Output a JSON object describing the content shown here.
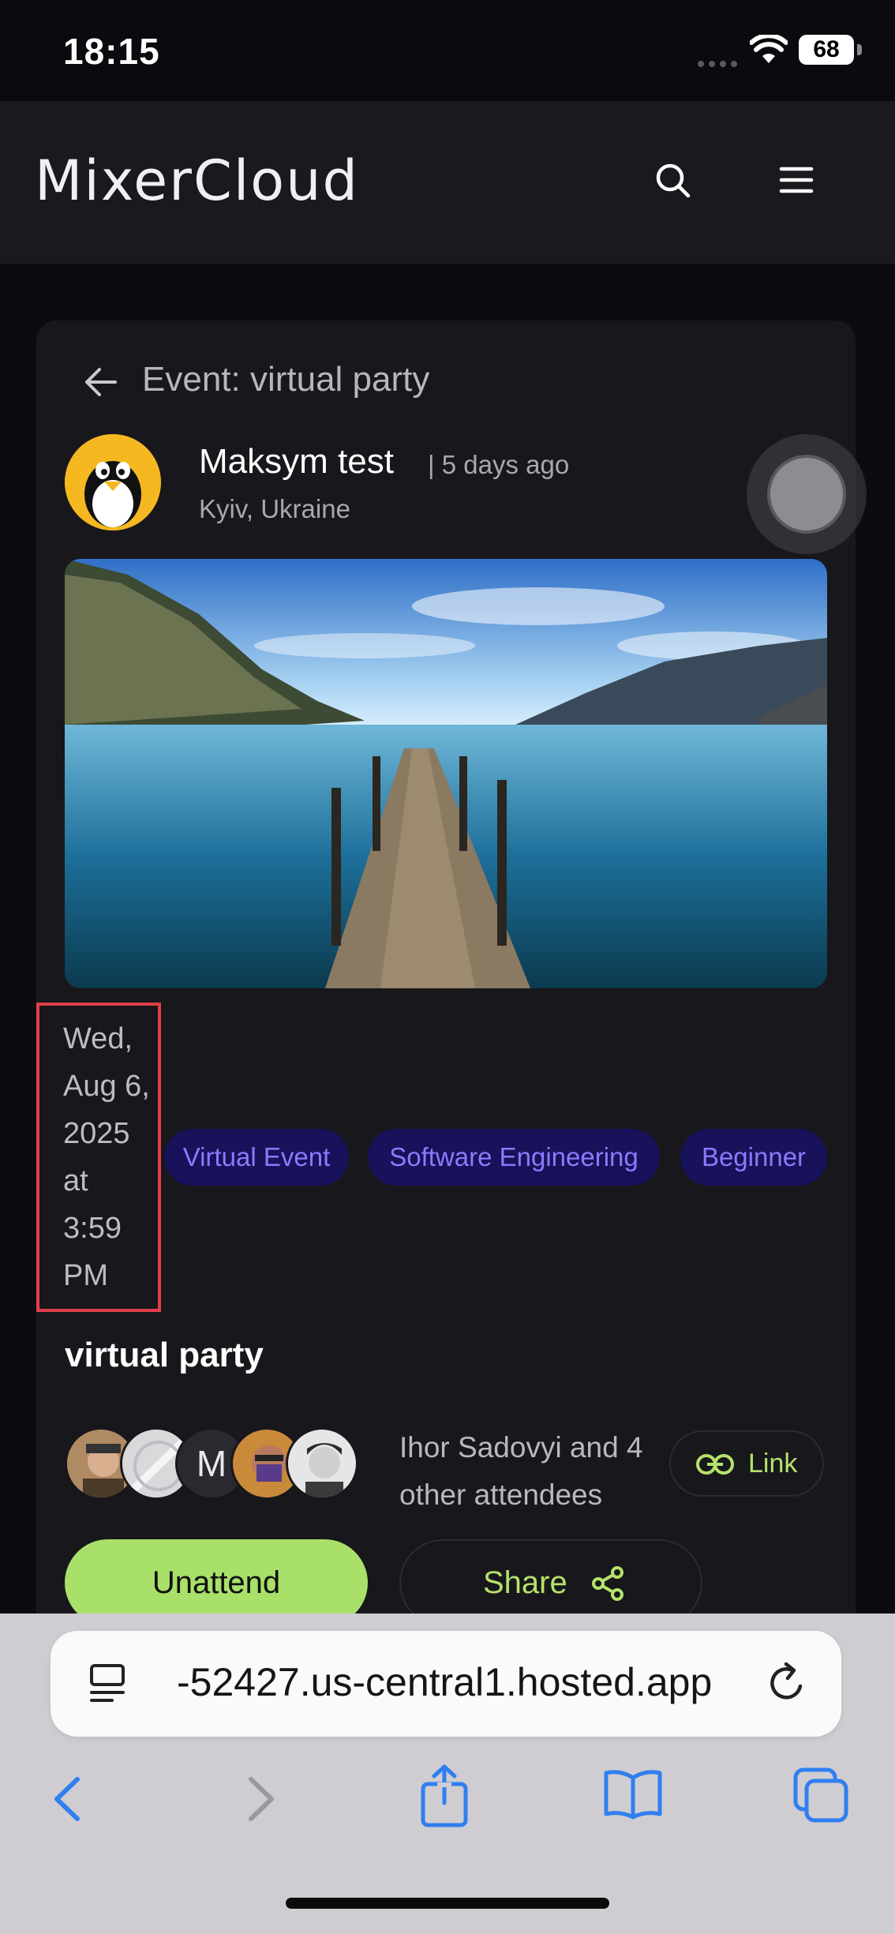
{
  "status_bar": {
    "time": "18:15",
    "battery": "68"
  },
  "header": {
    "logo": "MixerCloud"
  },
  "event": {
    "page_title": "Event: virtual party",
    "author_name": "Maksym test",
    "posted_ago": "| 5 days ago",
    "location": "Kyiv, Ukraine",
    "date_lines": [
      "Wed,",
      "Aug 6,",
      "2025",
      "at",
      "3:59",
      "PM"
    ],
    "tags": [
      "Virtual Event",
      "Software Engineering",
      "Beginner"
    ],
    "title": "virtual party",
    "attendee_initial": "M",
    "attendees_line1": "Ihor Sadovyi and 4",
    "attendees_line2": "other attendees",
    "link_label": "Link",
    "unattend_label": "Unattend",
    "share_label": "Share"
  },
  "browser": {
    "url": "-52427.us-central1.hosted.app"
  },
  "colors": {
    "accent_green": "#a8e06a",
    "tag_bg": "#17125a",
    "tag_text": "#8a7bff",
    "highlight_box": "#e0404a"
  }
}
